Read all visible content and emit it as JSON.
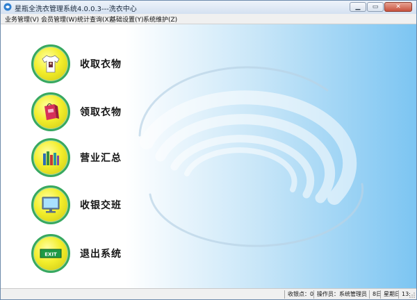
{
  "window": {
    "title": "星瓶全洗衣管理系统4.0.0.3---洗衣中心",
    "controls": {
      "minimize": "▁",
      "maximize": "▭",
      "close": "✕"
    }
  },
  "menu": [
    {
      "label": "业务管理(V)"
    },
    {
      "label": "会员管理(W)"
    },
    {
      "label": "统计查询(X)"
    },
    {
      "label": "基础设置(Y)"
    },
    {
      "label": "系统维护(Z)"
    }
  ],
  "nav": [
    {
      "label": "收取衣物",
      "icon": "tshirt-icon"
    },
    {
      "label": "领取衣物",
      "icon": "shopping-bag-icon"
    },
    {
      "label": "营业汇总",
      "icon": "books-icon"
    },
    {
      "label": "收银交班",
      "icon": "monitor-icon"
    },
    {
      "label": "退出系统",
      "icon": "exit-sign-icon",
      "sign_text": "EXIT"
    }
  ],
  "status": {
    "point": "收银点：0",
    "operator": "操作员：系统管理员",
    "date": "8日",
    "weekday": "星期日",
    "time": "13:"
  },
  "colors": {
    "circle_fill": "#f3ee2c",
    "circle_ring": "#37a860",
    "content_gradient_end": "#7cc5f2"
  }
}
